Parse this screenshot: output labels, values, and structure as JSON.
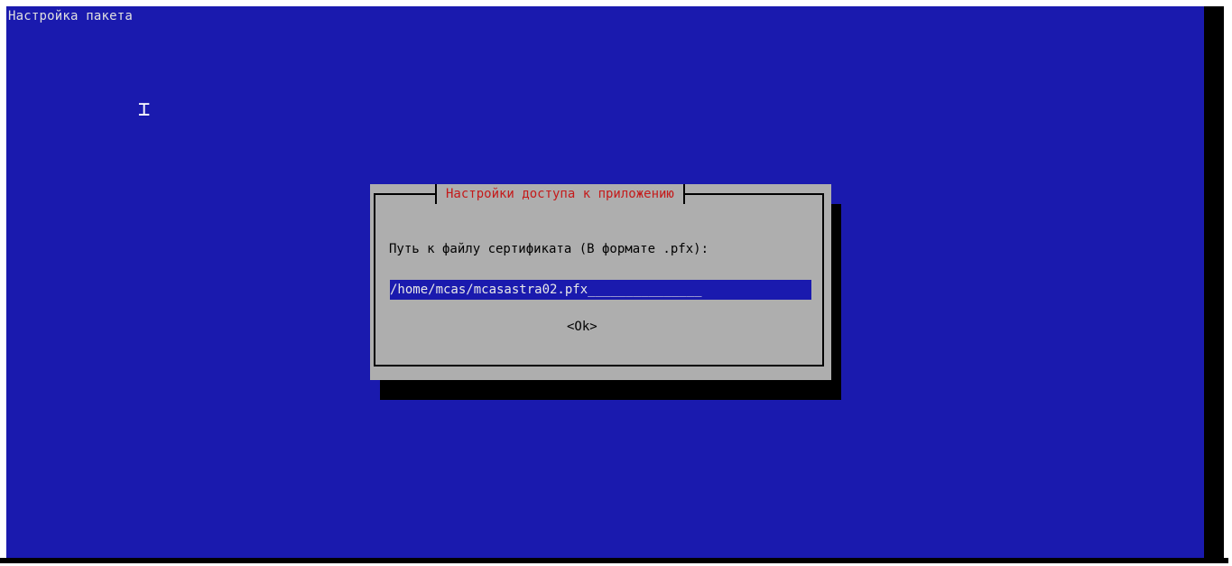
{
  "backtitle": "Настройка пакета",
  "dialog": {
    "title": "Настройки доступа к приложению",
    "prompt": "Путь к файлу сертификата (В формате .pfx):",
    "input_value": "/home/mcas/mcasastra02.pfx",
    "input_fill": "_______________",
    "ok_label": "<Ok>"
  },
  "colors": {
    "terminal_background": "#1a1aae",
    "dialog_background": "#aeaeae",
    "dialog_title": "#c41a1a",
    "input_background": "#1a1aae",
    "shadow": "#000000"
  },
  "icons": {
    "mouse_cursor": "i-beam-cursor-icon"
  }
}
